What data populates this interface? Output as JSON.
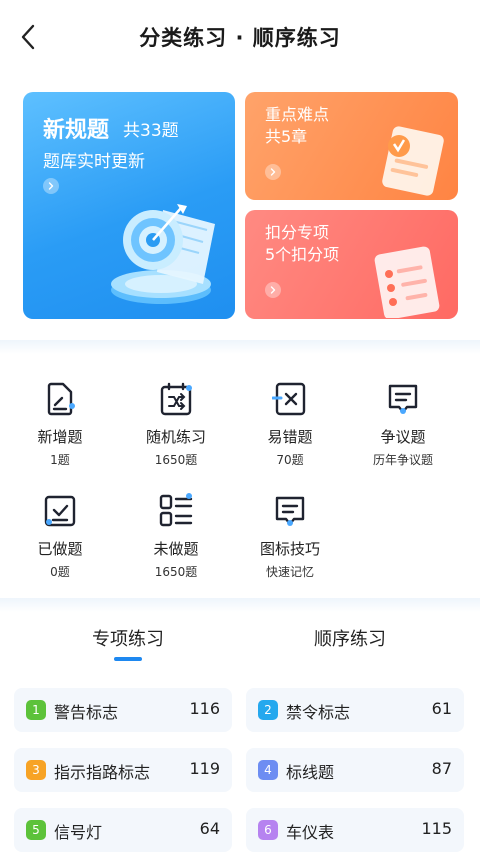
{
  "header": {
    "title": "分类练习 · 顺序练习",
    "back_icon": "chevron-left-icon"
  },
  "hero": {
    "main": {
      "title": "新规题",
      "count": "共33题",
      "subtitle": "题库实时更新",
      "color": "#2a9cf5"
    },
    "key_points": {
      "title": "重点难点",
      "subtitle": "共5章",
      "color": "#ff8a4f"
    },
    "deduction": {
      "title": "扣分专项",
      "subtitle": "5个扣分项",
      "color": "#ff6f68"
    }
  },
  "grid": [
    {
      "label": "新增题",
      "value": "1题",
      "icon": "new-doc-icon"
    },
    {
      "label": "随机练习",
      "value": "1650题",
      "icon": "shuffle-icon"
    },
    {
      "label": "易错题",
      "value": "70题",
      "icon": "error-icon"
    },
    {
      "label": "争议题",
      "value": "历年争议题",
      "icon": "dispute-icon"
    },
    {
      "label": "已做题",
      "value": "0题",
      "icon": "done-icon"
    },
    {
      "label": "未做题",
      "value": "1650题",
      "icon": "undone-list-icon"
    },
    {
      "label": "图标技巧",
      "value": "快速记忆",
      "icon": "tips-icon"
    }
  ],
  "tabs": [
    {
      "label": "专项练习",
      "active": true
    },
    {
      "label": "顺序练习",
      "active": false
    }
  ],
  "list": [
    {
      "num": "1",
      "label": "警告标志",
      "count": "116",
      "color": "#5cc23a"
    },
    {
      "num": "2",
      "label": "禁令标志",
      "count": "61",
      "color": "#25a8ee"
    },
    {
      "num": "3",
      "label": "指示指路标志",
      "count": "119",
      "color": "#f7a325"
    },
    {
      "num": "4",
      "label": "标线题",
      "count": "87",
      "color": "#6d8df2"
    },
    {
      "num": "5",
      "label": "信号灯",
      "count": "64",
      "color": "#5cc23a"
    },
    {
      "num": "6",
      "label": "车仪表",
      "count": "115",
      "color": "#b683f0"
    }
  ],
  "colors": {
    "accent": "#1e88f0",
    "icon_stroke": "#1f2330",
    "icon_accent": "#4aa8ff"
  }
}
